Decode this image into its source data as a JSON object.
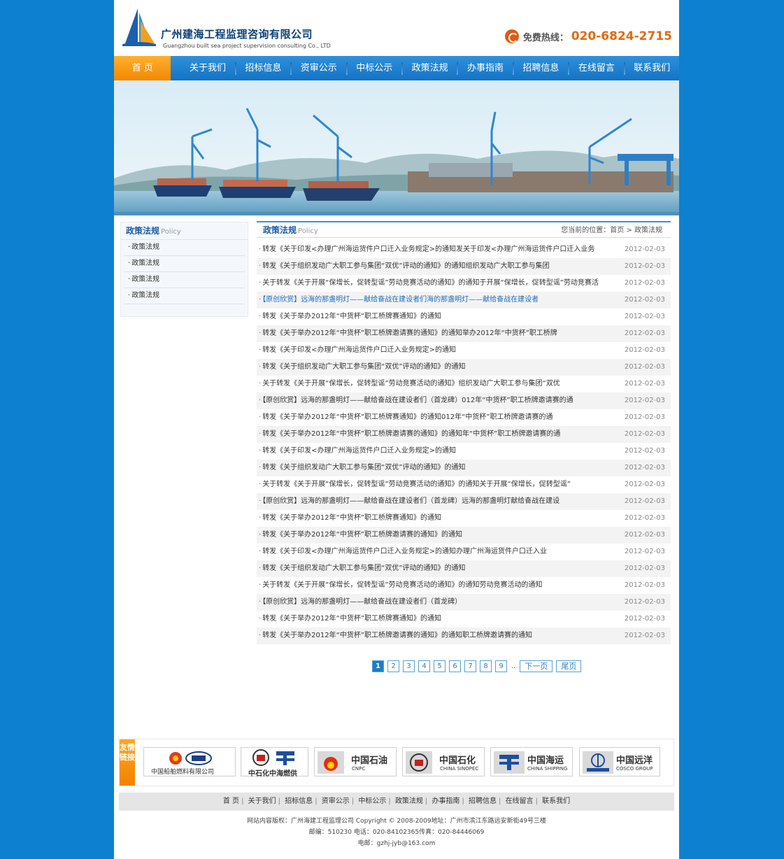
{
  "header": {
    "company_cn": "广州建海工程监理咨询有限公司",
    "company_en": "Guangzhou built sea project supervision consulting Co., LTD",
    "hotline_label": "免费热线：",
    "hotline_number": "020-6824-2715"
  },
  "nav": [
    "首 页",
    "关于我们",
    "招标信息",
    "资审公示",
    "中标公示",
    "政策法规",
    "办事指南",
    "招聘信息",
    "在线留言",
    "联系我们"
  ],
  "sidebar": {
    "title_cn": "政策法规",
    "title_en": "Policy",
    "items": [
      "政策法规",
      "政策法规",
      "政策法规",
      "政策法规"
    ]
  },
  "content": {
    "title_cn": "政策法规",
    "title_en": "Policy",
    "breadcrumb": "您当前的位置：首页 >  政策法规",
    "rows": [
      {
        "text": "转发《关于印发<办理广州海运货件户口迁入业务规定>的通知发关于印发<办理广州海运货件户口迁入业务",
        "date": "2012-02-03",
        "hl": false
      },
      {
        "text": "转发《关于组织发动广大职工参与集团“双优”评动的通知》的通知组织发动广大职工参与集团",
        "date": "2012-02-03",
        "hl": false
      },
      {
        "text": "关于转发《关于开展“保增长，促转型谣”劳动竞赛活动的通知》的通知于开展“保增长，促转型谣”劳动竞赛活",
        "date": "2012-02-03",
        "hl": false
      },
      {
        "text": "【原创欣赏】远海的那盏明灯——献给奋战在建设者们海的那盏明灯——献给奋战在建设者",
        "date": "2012-02-03",
        "hl": true
      },
      {
        "text": "转发《关于举办2012年“中货杯”职工桥牌赛通知》的通知",
        "date": "2012-02-03",
        "hl": false
      },
      {
        "text": "转发《关于举办2012年“中货杯”职工桥牌邀请赛的通知》的通知举办2012年“中货杯”职工桥牌",
        "date": "2012-02-03",
        "hl": false
      },
      {
        "text": "转发《关于印发<办理广州海运货件户口迁入业务规定>的通知",
        "date": "2012-02-03",
        "hl": false
      },
      {
        "text": "转发《关于组织发动广大职工参与集团“双优”评动的通知》的通知",
        "date": "2012-02-03",
        "hl": false
      },
      {
        "text": "关于转发《关于开展“保增长，促转型谣”劳动竞赛活动的通知》组织发动广大职工参与集团“双优",
        "date": "2012-02-03",
        "hl": false
      },
      {
        "text": "【原创欣赏】远海的那盏明灯——献给奋战在建设者们（首龙碑）012年“中货杯”职工桥牌邀请赛的通",
        "date": "2012-02-03",
        "hl": false
      },
      {
        "text": "转发《关于举办2012年“中货杯”职工桥牌赛通知》的通知012年“中货杯”职工桥牌邀请赛的通",
        "date": "2012-02-03",
        "hl": false
      },
      {
        "text": "转发《关于举办2012年“中货杯”职工桥牌邀请赛的通知》的通知年“中货杯”职工桥牌邀请赛的通",
        "date": "2012-02-03",
        "hl": false
      },
      {
        "text": "转发《关于印发<办理广州海运货件户口迁入业务规定>的通知",
        "date": "2012-02-03",
        "hl": false
      },
      {
        "text": "转发《关于组织发动广大职工参与集团“双优”评动的通知》的通知",
        "date": "2012-02-03",
        "hl": false
      },
      {
        "text": "关于转发《关于开展“保增长，促转型谣”劳动竞赛活动的通知》的通知关于开展“保增长，促转型谣”",
        "date": "2012-02-03",
        "hl": false
      },
      {
        "text": "【原创欣赏】远海的那盏明灯——献给奋战在建设者们（首龙碑）远海的那盏明灯献给奋战在建设",
        "date": "2012-02-03",
        "hl": false
      },
      {
        "text": "转发《关于举办2012年“中货杯”职工桥牌赛通知》的通知",
        "date": "2012-02-03",
        "hl": false
      },
      {
        "text": "转发《关于举办2012年“中货杯”职工桥牌邀请赛的通知》的通知",
        "date": "2012-02-03",
        "hl": false
      },
      {
        "text": "转发《关于印发<办理广州海运货件户口迁入业务规定>的通知办理广州海运货件户口迁入业",
        "date": "2012-02-03",
        "hl": false
      },
      {
        "text": "转发《关于组织发动广大职工参与集团“双优”评动的通知》的通知",
        "date": "2012-02-03",
        "hl": false
      },
      {
        "text": "关于转发《关于开展“保增长，促转型谣”劳动竞赛活动的通知》的通知劳动竞赛活动的通知",
        "date": "2012-02-03",
        "hl": false
      },
      {
        "text": "【原创欣赏】远海的那盏明灯——献给奋战在建设者们（首龙碑）",
        "date": "2012-02-03",
        "hl": false
      },
      {
        "text": "转发《关于举办2012年“中货杯”职工桥牌赛通知》的通知",
        "date": "2012-02-03",
        "hl": false
      },
      {
        "text": "转发《关于举办2012年“中货杯”职工桥牌邀请赛的通知》的通知职工桥牌邀请赛的通知",
        "date": "2012-02-03",
        "hl": false
      }
    ]
  },
  "pager": {
    "pages": [
      "1",
      "2",
      "3",
      "4",
      "5",
      "6",
      "7",
      "8",
      "9"
    ],
    "current": "1",
    "ellipsis": "..",
    "next": "下一页",
    "last": "尾页"
  },
  "links": {
    "tab": "友情链接",
    "logos": [
      {
        "cn": "中国船舶燃料有限公司"
      },
      {
        "cn": "中石化中海燃供"
      },
      {
        "cn": "中国石油",
        "en": "CNPC"
      },
      {
        "cn": "中国石化",
        "en": "CHINA SINOPEC"
      },
      {
        "cn": "中国海运",
        "en": "CHINA SHIPPING"
      },
      {
        "cn": "中国远洋",
        "en": "COSCO GROUP"
      }
    ]
  },
  "footer": {
    "nav": [
      "首 页",
      "关于我们",
      "招标信息",
      "资审公示",
      "中标公示",
      "政策法规",
      "办事指南",
      "招聘信息",
      "在线留言",
      "联系我们"
    ],
    "line1": "网站内容版权：广州海建工程监理公司 Copyright © 2008-2009地址：广州市滨江东路远安新街49号三楼",
    "line2": "邮编：510230 电话：020-84102365传真：020-84446069",
    "line3": "电邮：gzhj-jyb@163.com"
  },
  "colors": {
    "page_bg": "#0d80d0",
    "nav_bg": "#1473c4",
    "nav_active": "#f28800",
    "accent": "#1d6bbf"
  }
}
